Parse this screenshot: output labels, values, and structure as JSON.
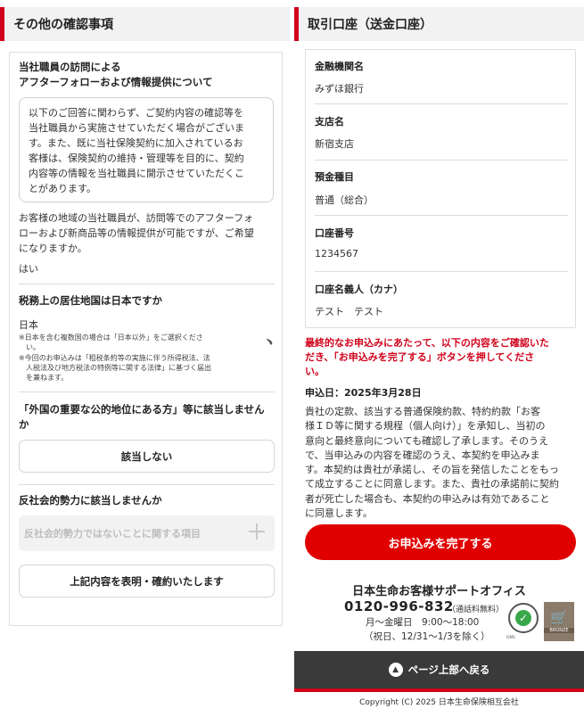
{
  "left": {
    "section_title": "その他の確認事項",
    "visit": {
      "title_line1": "当社職員の訪問による",
      "title_line2": "アフターフォローおよび情報提供について",
      "notice_lines": [
        "以下のご回答に関わらず、ご契約内容の確認等を",
        "当社職員から実施させていただく場合がございま",
        "す。また、既に当社保険契約に加入されているお",
        "客様は、保険契約の維持・管理等を目的に、契約",
        "内容等の情報を当社職員に開示させていただくこ",
        "とがあります。"
      ],
      "question_lines": [
        "お客様の地域の当社職員が、訪問等でのアフターフォ",
        "ローおよび新商品等の情報提供が可能ですが、ご希望",
        "になりますか。"
      ],
      "answer": "はい"
    },
    "tax": {
      "title": "税務上の居住地国は日本ですか",
      "answer": "日本",
      "note1_lines": [
        "※日本を含む複数国の場合は「日本以外」をご選択くださ",
        "　い。"
      ],
      "note2_lines": [
        "※今回のお申込みは「租税条約等の実施に伴う所得税法、法",
        "　人税法及び地方税法の特例等に関する法律」に基づく届出",
        "　を兼ねます。"
      ],
      "side_mark": "﹅"
    },
    "peps": {
      "title_line1": "「外国の重要な公的地位にある方」等に該当しません",
      "title_line2": "か",
      "button": "該当しない"
    },
    "antisocial": {
      "title": "反社会的勢力に該当しませんか",
      "accordion_label": "反社会的勢力ではないことに関する項目",
      "confirm_button": "上記内容を表明・確約いたします"
    }
  },
  "right": {
    "section_title": "取引口座（送金口座）",
    "account": [
      {
        "label": "金融機関名",
        "value": "みずほ銀行"
      },
      {
        "label": "支店名",
        "value": "新宿支店"
      },
      {
        "label": "預金種目",
        "value": "普通（総合）"
      },
      {
        "label": "口座番号",
        "value": "1234567"
      },
      {
        "label": "口座名義人（カナ）",
        "value": "テスト　テスト"
      }
    ],
    "warning_lines": [
      "最終的なお申込みにあたって、以下の内容をご確認いた",
      "だき、「お申込みを完了する」ボタンを押してくださ",
      "い。"
    ],
    "apply_date": "申込日：2025年3月28日",
    "terms_lines": [
      "貴社の定款、該当する普通保険約款、特約約款「お客",
      "様ＩＤ等に関する規程（個人向け）」を承知し、当初の",
      "意向と最終意向についても確認し了承します。そのうえ",
      "で、当申込みの内容を確認のうえ、本契約を申込みま",
      "す。本契約は貴社が承諾し、その旨を発信したことをもっ",
      "て成立することに同意します。また、貴社の承諾前に契約",
      "者が死亡した場合も、本契約の申込みは有効であること",
      "に同意します。"
    ],
    "submit_button": "お申込みを完了する",
    "support": {
      "name": "日本生命お客様サポートオフィス",
      "phone": "0120-996-832",
      "phone_note": "（通話料無料）",
      "hours": "月～金曜日　9:00～18:00",
      "holidays": "（祝日、12/31～1/3を除く）",
      "badge_text": "ISMS",
      "badge2_text": "BRONZE"
    },
    "back_to_top": "ページ上部へ戻る",
    "copyright": "Copyright (C) 2025 日本生命保険相互会社"
  }
}
